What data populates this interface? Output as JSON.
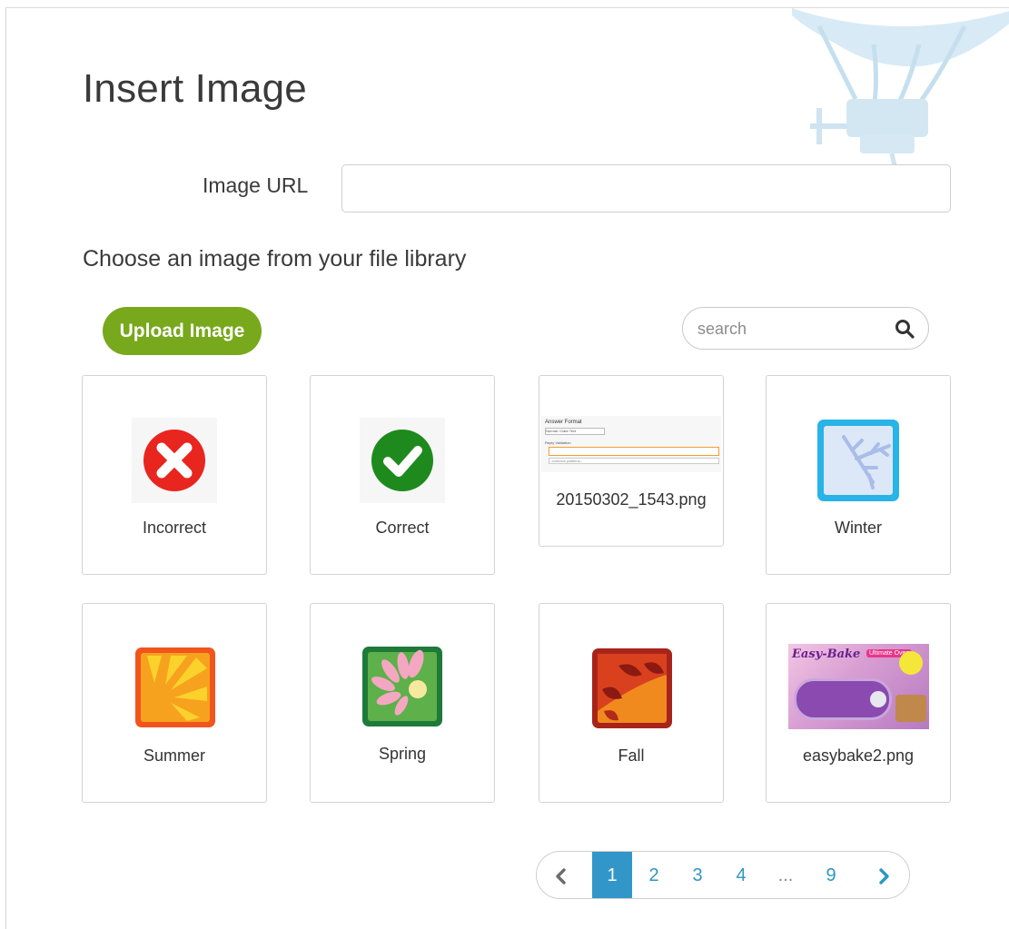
{
  "dialog": {
    "title": "Insert Image",
    "url_label": "Image URL",
    "url_value": "",
    "library_label": "Choose an image from your file library"
  },
  "toolbar": {
    "upload_label": "Upload Image",
    "search_placeholder": "search",
    "search_value": ""
  },
  "library": {
    "items": [
      {
        "label": "Incorrect",
        "icon": "x-circle-icon",
        "color": "#e8251f"
      },
      {
        "label": "Correct",
        "icon": "check-circle-icon",
        "color": "#1e8a1e"
      },
      {
        "label": "20150302_1543.png",
        "icon": "screenshot-thumbnail",
        "preview": {
          "heading": "Answer Format",
          "field1": "Normal / Date Text",
          "heading2": "Reply Validation",
          "field2": "--common patterns--"
        }
      },
      {
        "label": "Winter",
        "icon": "snowflake-icon",
        "color": "#29b3e6"
      },
      {
        "label": "Summer",
        "icon": "sun-icon",
        "color": "#f0551e"
      },
      {
        "label": "Spring",
        "icon": "flower-icon",
        "color": "#1f7a3a"
      },
      {
        "label": "Fall",
        "icon": "leaves-icon",
        "color": "#c0271e"
      },
      {
        "label": "easybake2.png",
        "icon": "photo-thumbnail",
        "preview": {
          "brand": "Easy-Bake",
          "sub": "Ultimate Oven"
        }
      }
    ]
  },
  "pagination": {
    "prev_icon": "chevron-left-icon",
    "next_icon": "chevron-right-icon",
    "pages": [
      "1",
      "2",
      "3",
      "4",
      "...",
      "9"
    ],
    "current": "1"
  },
  "colors": {
    "accent_green": "#78a81c",
    "accent_blue": "#3297c8"
  }
}
